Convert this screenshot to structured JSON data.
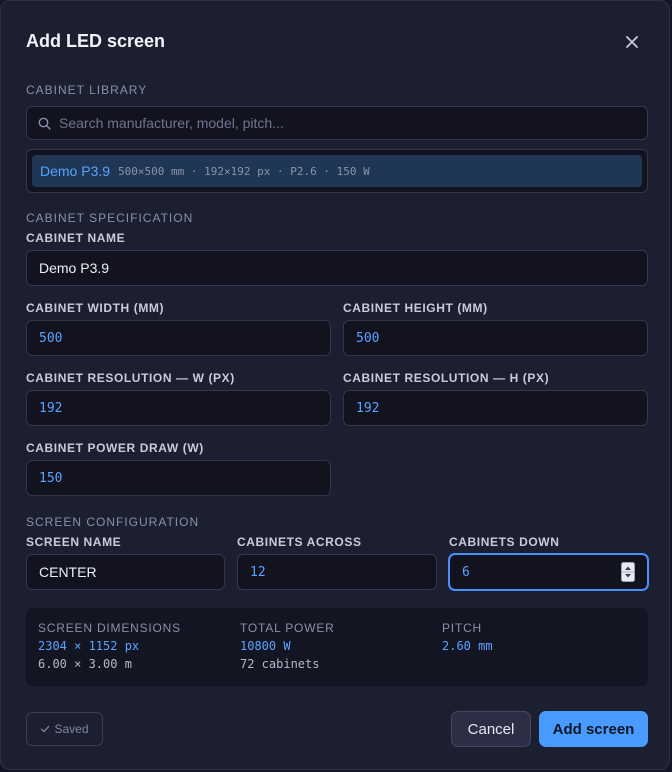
{
  "dialog": {
    "title": "Add LED screen"
  },
  "library": {
    "section": "CABINET LIBRARY",
    "search_placeholder": "Search manufacturer, model, pitch...",
    "item": {
      "name": "Demo P3.9",
      "meta": "500×500 mm · 192×192 px · P2.6 · 150 W"
    }
  },
  "spec": {
    "section": "CABINET SPECIFICATION",
    "name_label": "CABINET NAME",
    "name_value": "Demo P3.9",
    "width_label": "CABINET WIDTH (MM)",
    "width_value": "500",
    "height_label": "CABINET HEIGHT (MM)",
    "height_value": "500",
    "resw_label": "CABINET RESOLUTION — W (PX)",
    "resw_value": "192",
    "resh_label": "CABINET RESOLUTION — H (PX)",
    "resh_value": "192",
    "power_label": "CABINET POWER DRAW (W)",
    "power_value": "150"
  },
  "config": {
    "section": "SCREEN CONFIGURATION",
    "screen_name_label": "SCREEN NAME",
    "screen_name_value": "CENTER",
    "across_label": "CABINETS ACROSS",
    "across_value": "12",
    "down_label": "CABINETS DOWN",
    "down_value": "6"
  },
  "summary": {
    "dims_label": "SCREEN DIMENSIONS",
    "dims_px": "2304 × 1152 px",
    "dims_m": "6.00 × 3.00 m",
    "power_label": "TOTAL POWER",
    "power_value": "10800 W",
    "cabinets": "72 cabinets",
    "pitch_label": "PITCH",
    "pitch_value": "2.60 mm"
  },
  "footer": {
    "saved": "Saved",
    "cancel": "Cancel",
    "add": "Add screen"
  },
  "colors": {
    "accent": "#4a9bff",
    "background": "#1c1f30"
  }
}
